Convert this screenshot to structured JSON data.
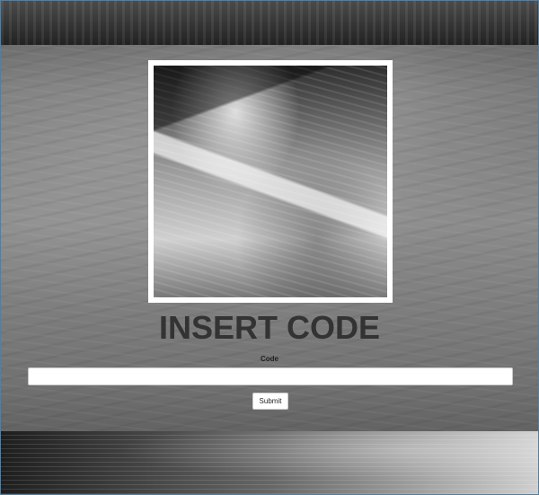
{
  "form": {
    "title": "INSERT CODE",
    "code_label": "Code",
    "code_value": "",
    "submit_label": "Submit"
  },
  "images": {
    "main": "shoreline-photo"
  }
}
